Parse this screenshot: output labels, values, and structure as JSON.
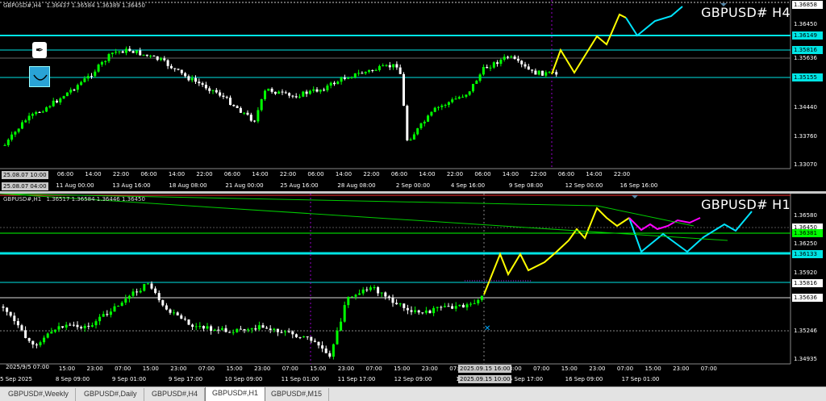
{
  "charts": [
    {
      "id": "h4",
      "header_symbol": "GBPUSD#,H4",
      "header_ohlc": "1.36437 1.36584 1.36389 1.36450",
      "big_title": "GBPUSD# H4",
      "price_labels": [
        {
          "text": "1.36858",
          "style": "white"
        },
        {
          "text": "1.36450",
          "style": "plain"
        },
        {
          "text": "1.36149",
          "style": "cyan"
        },
        {
          "text": "1.35816",
          "style": "cyan"
        },
        {
          "text": "1.35636",
          "style": "plain"
        },
        {
          "text": "1.35155",
          "style": "cyan"
        },
        {
          "text": "1.34440",
          "style": "plain"
        },
        {
          "text": "1.33760",
          "style": "plain"
        },
        {
          "text": "1.33070",
          "style": "plain"
        }
      ],
      "time_labels": [
        "06:00",
        "14:00",
        "22:00",
        "06:00",
        "14:00",
        "22:00",
        "06:00",
        "14:00",
        "22:00",
        "06:00",
        "14:00",
        "22:00",
        "06:00",
        "14:00",
        "22:00",
        "06:00",
        "14:00",
        "22:00",
        "06:00",
        "14:00",
        "22:00"
      ],
      "date_labels": [
        "11 Aug 00:00",
        "13 Aug 16:00",
        "18 Aug 08:00",
        "21 Aug 00:00",
        "25 Aug 16:00",
        "28 Aug 08:00",
        "2 Sep 00:00",
        "4 Sep 16:00",
        "9 Sep 08:00",
        "12 Sep 00:00",
        "16 Sep 16:00"
      ],
      "cursor_box_top": "25.08.07 10:00",
      "cursor_box_bottom": "25.08.07 04:00"
    },
    {
      "id": "h1",
      "header_symbol": "GBPUSD#,H1",
      "header_ohlc": "1.36517 1.36584 1.36446 1.36450",
      "big_title": "GBPUSD# H1",
      "price_labels": [
        {
          "text": "1.36580",
          "style": "plain"
        },
        {
          "text": "1.36450",
          "style": "white"
        },
        {
          "text": "1.36381",
          "style": "green"
        },
        {
          "text": "1.36250",
          "style": "plain"
        },
        {
          "text": "1.36133",
          "style": "cyan"
        },
        {
          "text": "1.35920",
          "style": "plain"
        },
        {
          "text": "1.35816",
          "style": "white"
        },
        {
          "text": "1.35636",
          "style": "white"
        },
        {
          "text": "1.35246",
          "style": "plain"
        },
        {
          "text": "1.34935",
          "style": "plain"
        }
      ],
      "time_labels": [
        "15:00",
        "23:00",
        "07:00",
        "15:00",
        "23:00",
        "07:00",
        "15:00",
        "23:00",
        "07:00",
        "15:00",
        "23:00",
        "07:00",
        "15:00",
        "23:00",
        "07:00",
        "15:00",
        "23:00",
        "07:00",
        "15:00",
        "23:00",
        "07:00",
        "15:00",
        "23:00",
        "07:00"
      ],
      "date_labels": [
        "5 Sep 2025",
        "8 Sep 09:00",
        "9 Sep 01:00",
        "9 Sep 17:00",
        "10 Sep 09:00",
        "11 Sep 01:00",
        "11 Sep 17:00",
        "12 Sep 09:00",
        "1 2025.09.15 10:00",
        "5 Sep 17:00",
        "16 Sep 09:00",
        "17 Sep 01:00"
      ],
      "cursor_box_top": "2025.09.15 16:00",
      "cursor_box_bottom": "2025.09.15 10:00",
      "left_time_label": "2025/9/5 07:00"
    }
  ],
  "tabs": [
    {
      "label": "GBPUSD#,Weekly",
      "active": false
    },
    {
      "label": "GBPUSD#,Daily",
      "active": false
    },
    {
      "label": "GBPUSD#,H4",
      "active": false
    },
    {
      "label": "GBPUSD#,H1",
      "active": true
    },
    {
      "label": "GBPUSD#,M15",
      "active": false
    }
  ],
  "colors": {
    "bull": "#00ff00",
    "bear": "#ffffff",
    "zigzag": "#ffff00",
    "forecast": "#00e5ff",
    "forecast_alt": "#ff00ff",
    "level": "#00e5e5",
    "trend": "#00cc00",
    "vline": "#9900cc"
  },
  "icons": [
    "pen-icon",
    "smile-icon",
    "close-x-icon"
  ]
}
